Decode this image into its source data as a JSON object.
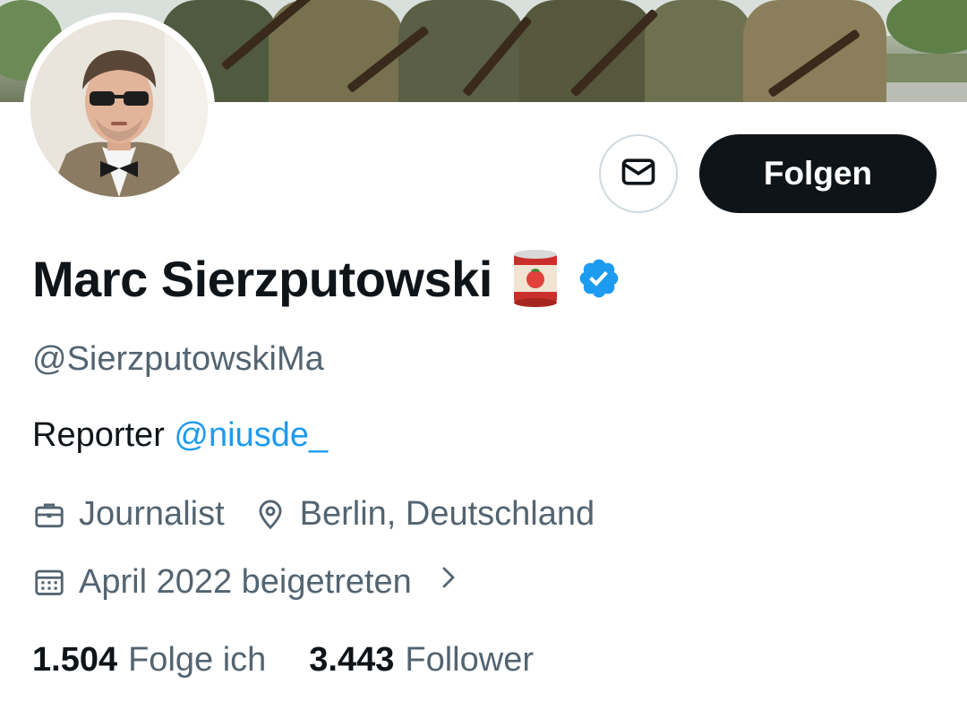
{
  "profile": {
    "name": "Marc Sierzputowski",
    "handle": "@SierzputowskiMa",
    "bio_prefix": "Reporter ",
    "bio_mention": "@niusde_",
    "profession": "Journalist",
    "location": "Berlin, Deutschland",
    "joined": "April 2022 beigetreten"
  },
  "actions": {
    "follow_label": "Folgen"
  },
  "stats": {
    "following_count": "1.504",
    "following_label": "Folge ich",
    "followers_count": "3.443",
    "followers_label": "Follower"
  },
  "icons": {
    "message": "envelope-icon",
    "name_emoji": "tomato-can-icon",
    "verified": "verified-badge-icon",
    "profession": "briefcase-icon",
    "location": "location-pin-icon",
    "joined": "calendar-icon",
    "joined_more": "chevron-right-icon"
  },
  "colors": {
    "text_primary": "#0f1419",
    "text_secondary": "#536471",
    "accent_link": "#1d9bf0",
    "verified_blue": "#1d9bf0",
    "button_dark": "#0f1419"
  }
}
